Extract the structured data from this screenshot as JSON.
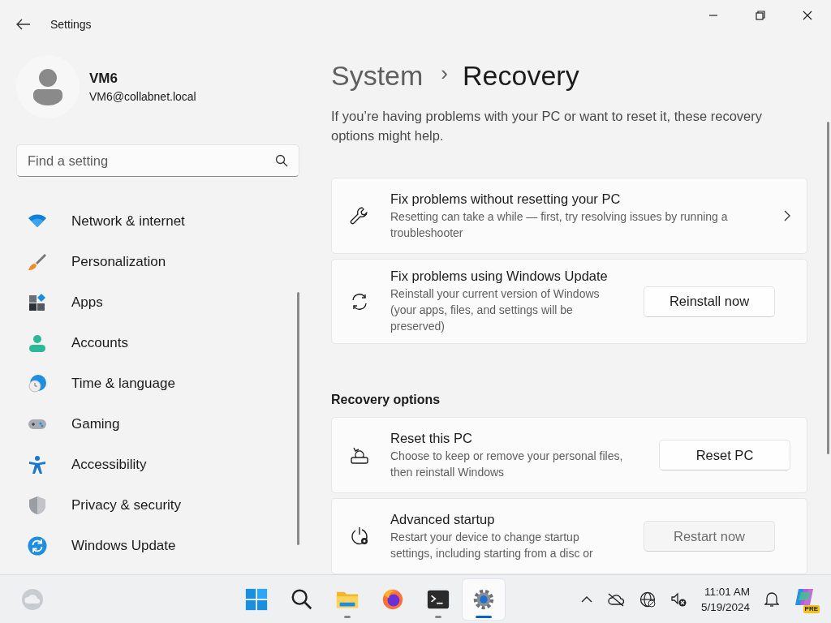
{
  "window": {
    "title": "Settings"
  },
  "user": {
    "name": "VM6",
    "email": "VM6@collabnet.local"
  },
  "search": {
    "placeholder": "Find a setting"
  },
  "sidebar": {
    "items": [
      {
        "label": "Network & internet"
      },
      {
        "label": "Personalization"
      },
      {
        "label": "Apps"
      },
      {
        "label": "Accounts"
      },
      {
        "label": "Time & language"
      },
      {
        "label": "Gaming"
      },
      {
        "label": "Accessibility"
      },
      {
        "label": "Privacy & security"
      },
      {
        "label": "Windows Update"
      }
    ]
  },
  "breadcrumb": {
    "parent": "System",
    "separator": "›",
    "current": "Recovery"
  },
  "intro": "If you’re having problems with your PC or want to reset it, these recovery options might help.",
  "sections": [
    {
      "cards": [
        {
          "kind": "link",
          "title": "Fix problems without resetting your PC",
          "description": "Resetting can take a while — first, try resolving issues by running a troubleshooter"
        },
        {
          "kind": "button",
          "title": "Fix problems using Windows Update",
          "description": "Reinstall your current version of Windows (your apps, files, and settings will be preserved)",
          "button": {
            "label": "Reinstall now",
            "hovered": false
          }
        }
      ]
    },
    {
      "heading": "Recovery options",
      "cards": [
        {
          "kind": "button",
          "title": "Reset this PC",
          "description": "Choose to keep or remove your personal files, then reinstall Windows",
          "button": {
            "label": "Reset PC",
            "hovered": false
          }
        },
        {
          "kind": "button",
          "title": "Advanced startup",
          "description": "Restart your device to change startup settings, including starting from a disc or",
          "button": {
            "label": "Restart now",
            "hovered": true
          }
        }
      ]
    }
  ],
  "taskbar": {
    "apps": [
      {
        "kind": "start",
        "running": false,
        "active": false
      },
      {
        "kind": "search",
        "running": false,
        "active": false
      },
      {
        "kind": "files",
        "running": true,
        "active": false
      },
      {
        "kind": "browser",
        "running": false,
        "active": false
      },
      {
        "kind": "terminal",
        "running": true,
        "active": false
      },
      {
        "kind": "settings",
        "running": true,
        "active": true
      }
    ],
    "time": "11:01 AM",
    "date": "5/19/2024",
    "badge": "PRE"
  }
}
